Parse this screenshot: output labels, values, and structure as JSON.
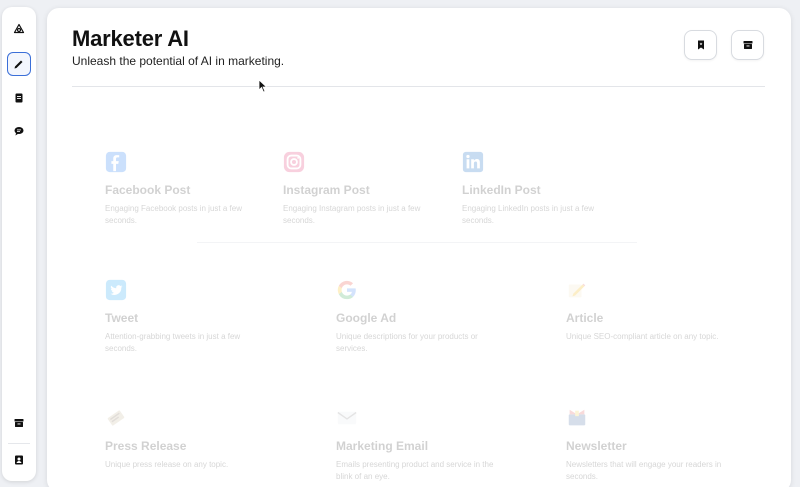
{
  "header": {
    "title": "Marketer AI",
    "subtitle": "Unleash the potential of AI in marketing."
  },
  "sidebar": {
    "items": [
      {
        "icon": "logo-icon"
      },
      {
        "icon": "pencil-icon",
        "active": true
      },
      {
        "icon": "document-icon"
      },
      {
        "icon": "chat-icon"
      },
      {
        "icon": "archive-icon"
      },
      {
        "icon": "contact-icon"
      }
    ]
  },
  "header_buttons": [
    {
      "icon": "bookmark-icon"
    },
    {
      "icon": "archive-icon"
    }
  ],
  "cards": [
    {
      "title": "Facebook Post",
      "desc": "Engaging Facebook posts in just a few seconds.",
      "icon": "facebook-icon"
    },
    {
      "title": "Instagram Post",
      "desc": "Engaging Instagram posts in just a few seconds.",
      "icon": "instagram-icon"
    },
    {
      "title": "LinkedIn Post",
      "desc": "Engaging LinkedIn posts in just a few seconds.",
      "icon": "linkedin-icon"
    },
    {
      "title": "Tweet",
      "desc": "Attention-grabbing tweets in just a few seconds.",
      "icon": "twitter-icon"
    },
    {
      "title": "Google Ad",
      "desc": "Unique descriptions for your products or services.",
      "icon": "google-icon"
    },
    {
      "title": "Article",
      "desc": "Unique SEO-compliant article on any topic.",
      "icon": "article-icon"
    },
    {
      "title": "Press Release",
      "desc": "Unique press release on any topic.",
      "icon": "press-release-icon"
    },
    {
      "title": "Marketing Email",
      "desc": "Emails presenting product and service in the blink of an eye.",
      "icon": "email-icon"
    },
    {
      "title": "Newsletter",
      "desc": "Newsletters that will engage your readers in seconds.",
      "icon": "newsletter-icon"
    }
  ],
  "colors": {
    "accent": "#3b6fd8",
    "facebook": "#1877f2",
    "instagram": "#e1306c",
    "linkedin": "#0a66c2",
    "twitter": "#1da1f2"
  }
}
